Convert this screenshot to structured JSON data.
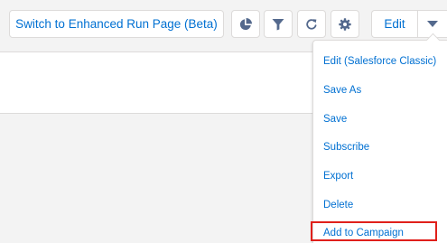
{
  "toolbar": {
    "switch_label": "Switch to Enhanced Run Page (Beta)",
    "edit_label": "Edit",
    "icons": [
      "pie-chart-icon",
      "filter-icon",
      "refresh-icon",
      "gear-icon",
      "chevron-down-icon"
    ]
  },
  "menu": {
    "items": [
      {
        "label": "Edit (Salesforce Classic)"
      },
      {
        "label": "Save As"
      },
      {
        "label": "Save"
      },
      {
        "label": "Subscribe"
      },
      {
        "label": "Export"
      },
      {
        "label": "Delete"
      },
      {
        "label": "Add to Campaign"
      }
    ],
    "highlighted": "Add to Campaign"
  },
  "colors": {
    "link": "#0070d2",
    "icon": "#54698d",
    "border": "#dddbda",
    "background": "#f3f3f3",
    "highlight": "#e0201b"
  }
}
